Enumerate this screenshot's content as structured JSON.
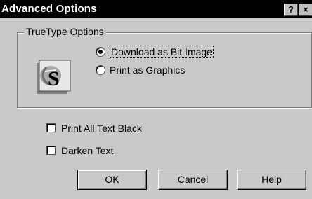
{
  "window": {
    "title": "Advanced Options",
    "help_button": "?",
    "close_button": "×"
  },
  "truetype": {
    "group_label": "TrueType Options",
    "icon": "truetype-icon",
    "options": [
      {
        "label": "Download as Bit Image",
        "selected": true
      },
      {
        "label": "Print as Graphics",
        "selected": false
      }
    ]
  },
  "checkboxes": [
    {
      "label": "Print All Text Black",
      "checked": false
    },
    {
      "label": "Darken Text",
      "checked": false
    }
  ],
  "buttons": {
    "ok": "OK",
    "cancel": "Cancel",
    "help": "Help"
  }
}
